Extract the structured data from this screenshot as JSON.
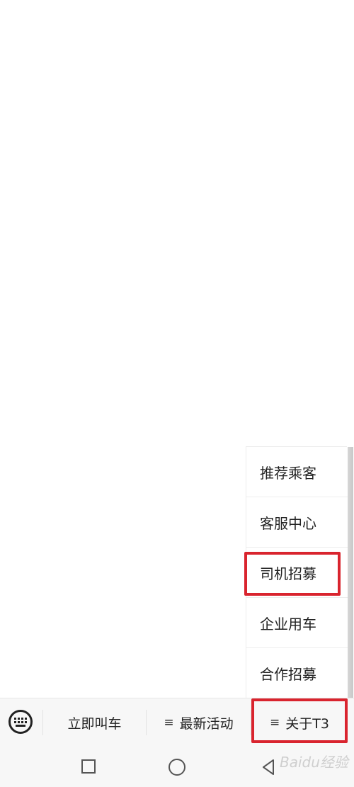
{
  "popup_menu": {
    "items": [
      {
        "label": "推荐乘客"
      },
      {
        "label": "客服中心"
      },
      {
        "label": "司机招募"
      },
      {
        "label": "企业用车"
      },
      {
        "label": "合作招募"
      }
    ]
  },
  "toolbar": {
    "keyboard_icon": "keyboard-icon",
    "items": [
      {
        "label": "立即叫车"
      },
      {
        "label": "最新活动",
        "glyph": "≡"
      },
      {
        "label": "关于T3",
        "glyph": "≡"
      }
    ]
  },
  "system_nav": {
    "icons": [
      "recent-apps-icon",
      "home-icon",
      "back-icon"
    ]
  },
  "watermark": {
    "text": "Baidu经验"
  },
  "colors": {
    "highlight": "#d9242e",
    "toolbar_bg": "#f7f7f7",
    "text": "#222222"
  }
}
